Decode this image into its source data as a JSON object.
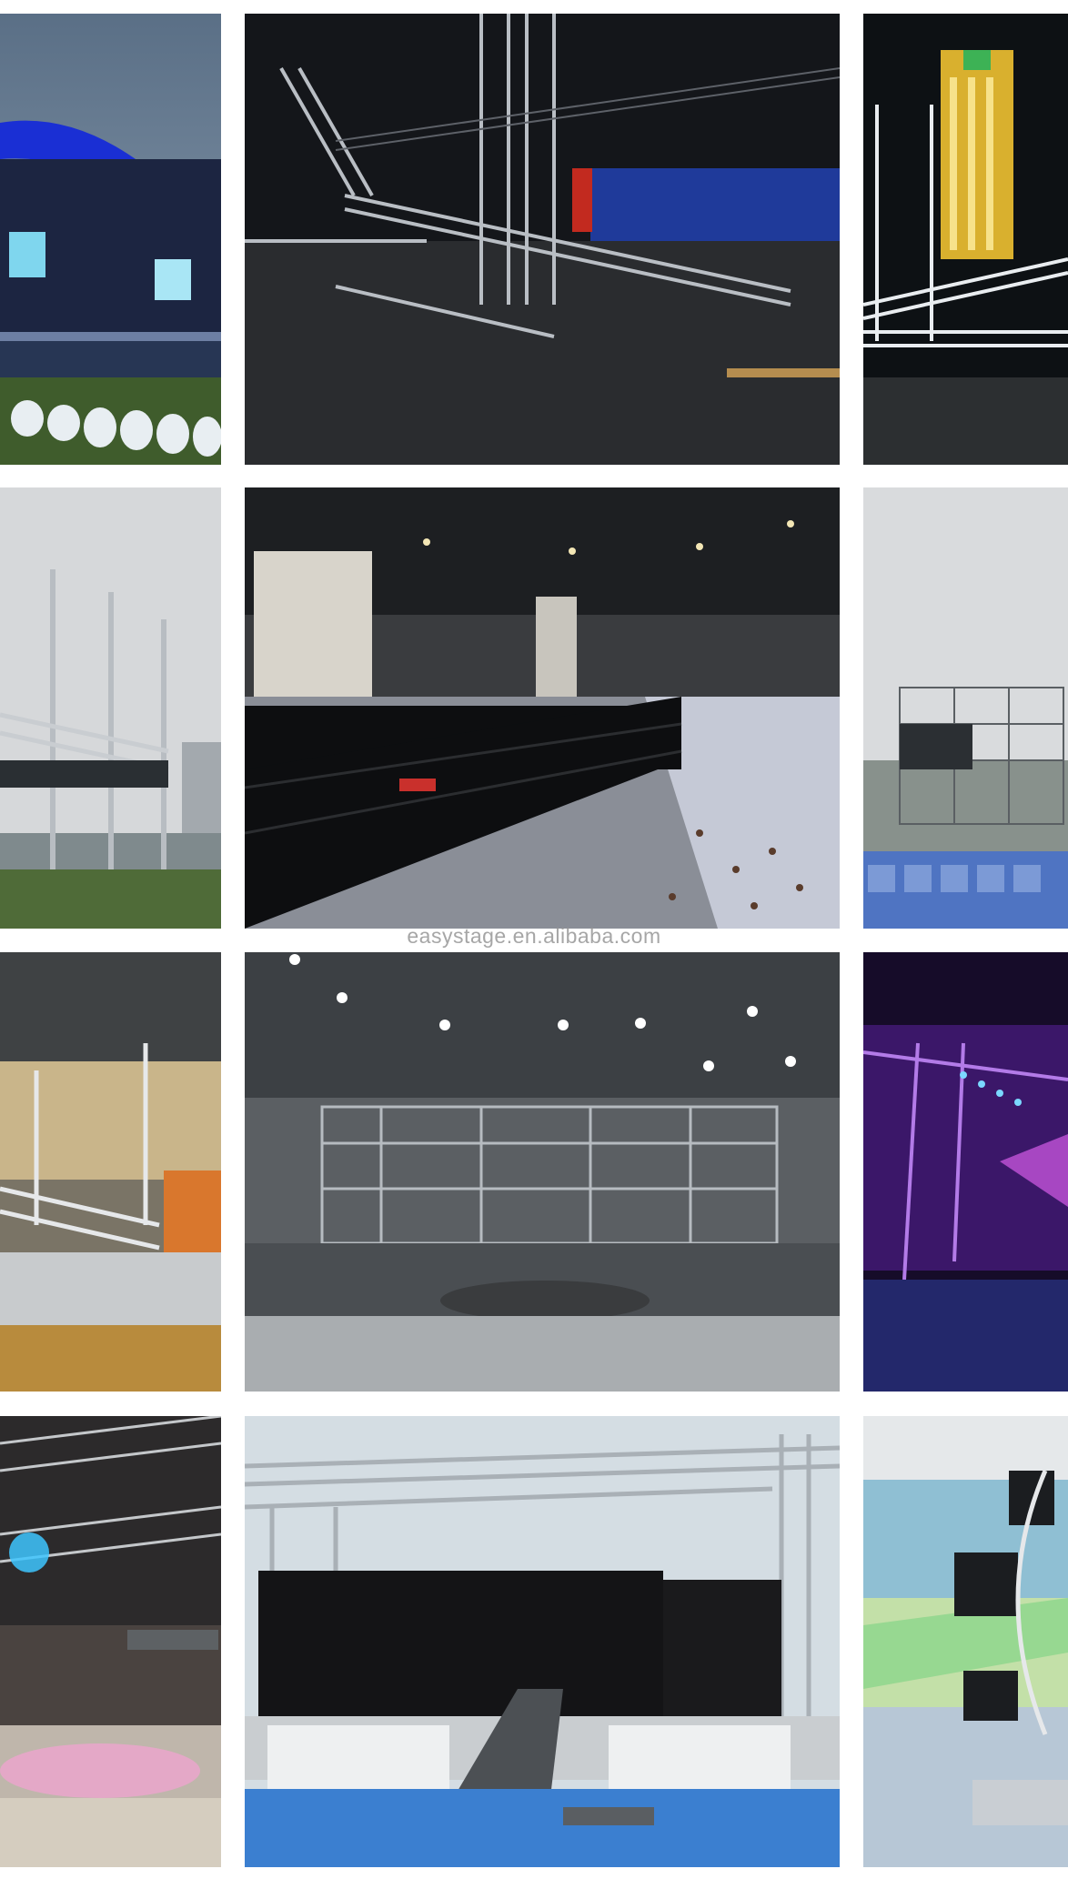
{
  "watermark": "easystage.en.alibaba.com",
  "photos": [
    {
      "id": "r1c1",
      "subject": "outdoor-stage-blue-roof-photo"
    },
    {
      "id": "r1c2",
      "subject": "truss-ramp-night-photo"
    },
    {
      "id": "r1c3",
      "subject": "night-city-truss-photo"
    },
    {
      "id": "r2c1",
      "subject": "outdoor-truss-towers-photo"
    },
    {
      "id": "r2c2",
      "subject": "exhibition-hall-truss-photo"
    },
    {
      "id": "r2c3",
      "subject": "outdoor-stage-scaffold-photo"
    },
    {
      "id": "r3c1",
      "subject": "gym-stage-platforms-photo"
    },
    {
      "id": "r3c2",
      "subject": "arena-round-stage-photo"
    },
    {
      "id": "r3c3",
      "subject": "purple-concert-stage-photo"
    },
    {
      "id": "r4c1",
      "subject": "banquet-hall-lighting-photo"
    },
    {
      "id": "r4c2",
      "subject": "outdoor-runway-truss-photo"
    },
    {
      "id": "r4c3",
      "subject": "moving-head-lights-photo"
    }
  ]
}
